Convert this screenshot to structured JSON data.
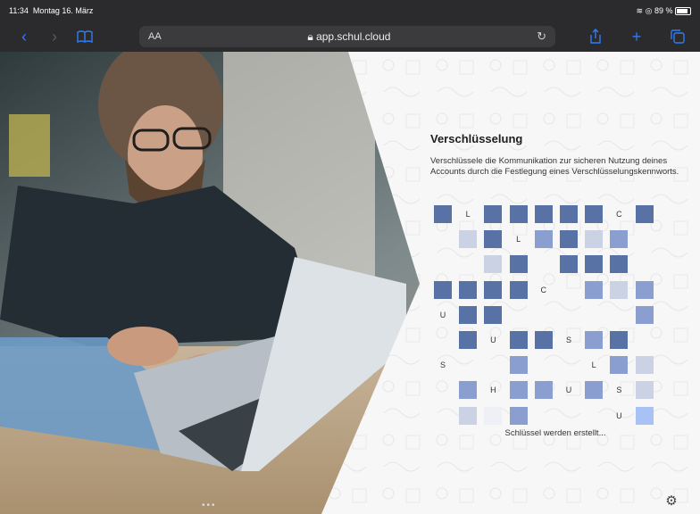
{
  "status_bar": {
    "time": "11:34",
    "date": "Montag 16. März",
    "battery": "89 %"
  },
  "browser": {
    "aa_label": "AA",
    "url": "app.schul.cloud"
  },
  "panel": {
    "title": "Verschlüsselung",
    "description": "Verschlüssele die Kommunikation zur sicheren Nutzung deines Accounts durch die Festlegung eines Verschlüsselungskennworts.",
    "status": "Schlüssel werden erstellt..."
  },
  "key_grid": {
    "rows": [
      [
        "dark",
        "L",
        "dark",
        "dark",
        "dark",
        "dark",
        "dark",
        "C",
        "dark"
      ],
      [
        "",
        "light",
        "dark",
        "L",
        "mid",
        "dark",
        "light",
        "mid",
        ""
      ],
      [
        "",
        "",
        "light",
        "dark",
        "",
        "dark",
        "dark",
        "dark",
        ""
      ],
      [
        "dark",
        "dark",
        "dark",
        "dark",
        "C",
        "",
        "mid",
        "light",
        "mid"
      ],
      [
        "U",
        "dark",
        "dark",
        "",
        "",
        "",
        "",
        "",
        "mid"
      ],
      [
        "",
        "dark",
        "U",
        "dark",
        "dark",
        "S",
        "mid",
        "dark",
        ""
      ],
      [
        "S",
        "",
        "",
        "mid",
        "",
        "",
        "L",
        "mid",
        "light"
      ],
      [
        "",
        "mid",
        "H",
        "mid",
        "mid",
        "U",
        "mid",
        "S",
        "light"
      ],
      [
        "",
        "light",
        "pale",
        "mid",
        "",
        "",
        "",
        "U",
        "bright"
      ]
    ],
    "colors": {
      "dark": "#5872a6",
      "mid": "#8a9fd0",
      "light": "#cbd2e3",
      "pale": "#eef0f6",
      "bright": "#a9c2f5"
    }
  }
}
